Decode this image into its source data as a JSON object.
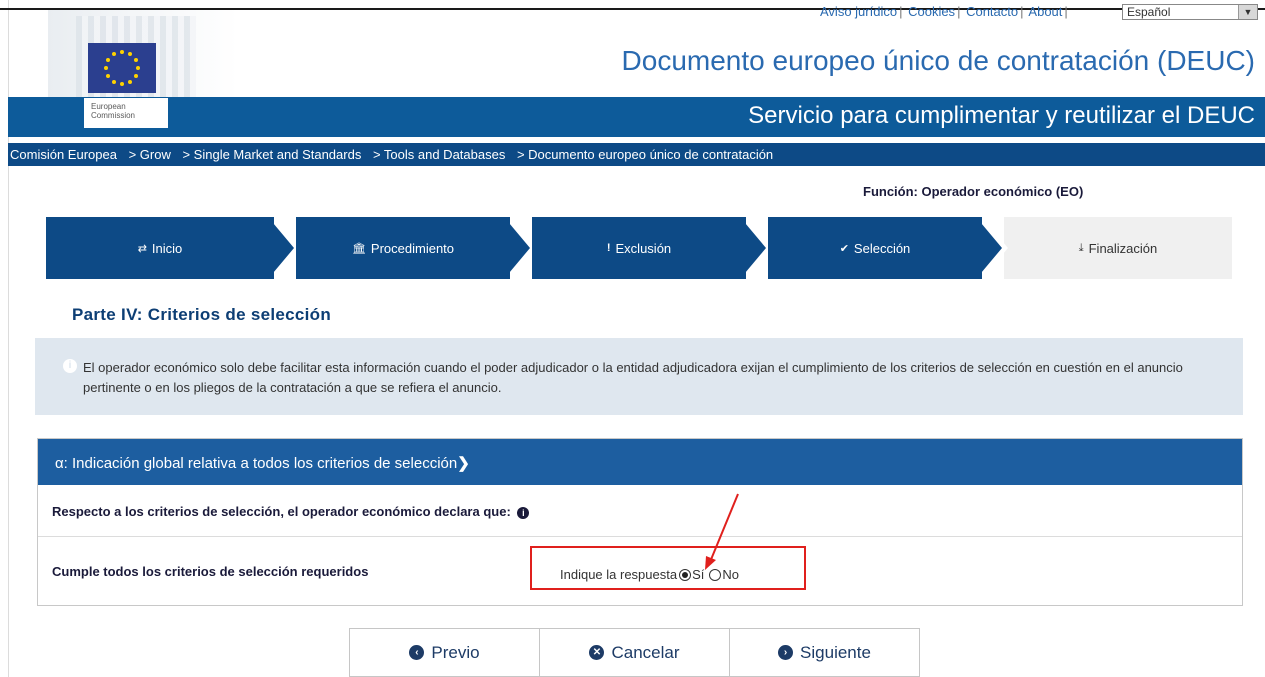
{
  "header": {
    "top_links": [
      "Aviso jurídico",
      "Cookies",
      "Contacto",
      "About"
    ],
    "language": "Español",
    "org_label_line1": "European",
    "org_label_line2": "Commission",
    "title": "Documento europeo único de contratación (DEUC)",
    "subtitle": "Servicio para cumplimentar y reutilizar el DEUC"
  },
  "breadcrumb": [
    "Comisión Europea",
    "> Grow",
    "> Single Market and Standards",
    "> Tools and Databases",
    "> Documento europeo único de contratación"
  ],
  "role": "Función: Operador económico (EO)",
  "steps": [
    {
      "label": "Inicio",
      "icon": "shuffle-icon"
    },
    {
      "label": "Procedimiento",
      "icon": "bank-icon"
    },
    {
      "label": "Exclusión",
      "icon": "exclamation-icon"
    },
    {
      "label": "Selección",
      "icon": "check-circle-icon"
    },
    {
      "label": "Finalización",
      "icon": "download-icon"
    }
  ],
  "main": {
    "heading": "Parte IV: Criterios de selección",
    "info_text": "El operador económico solo debe facilitar esta información cuando el poder adjudicador o la entidad adjudicadora exijan el cumplimiento de los criterios de selección en cuestión en el anuncio pertinente o en los pliegos de la contratación a que se refiera el anuncio.",
    "panel_title": "α: Indicación global relativa a todos los criterios de selección",
    "declare_text": "Respecto a los criterios de selección, el operador económico declara que:",
    "question": "Cumple todos los criterios de selección requeridos",
    "answer_prompt": "Indique la respuesta",
    "option_yes": "Sí",
    "option_no": "No",
    "selected": "Sí"
  },
  "buttons": {
    "prev": "Previo",
    "cancel": "Cancelar",
    "next": "Siguiente"
  },
  "colors": {
    "primary": "#0d5b9a",
    "dark_blue": "#0d4a86",
    "annotation_red": "#e0201d"
  }
}
